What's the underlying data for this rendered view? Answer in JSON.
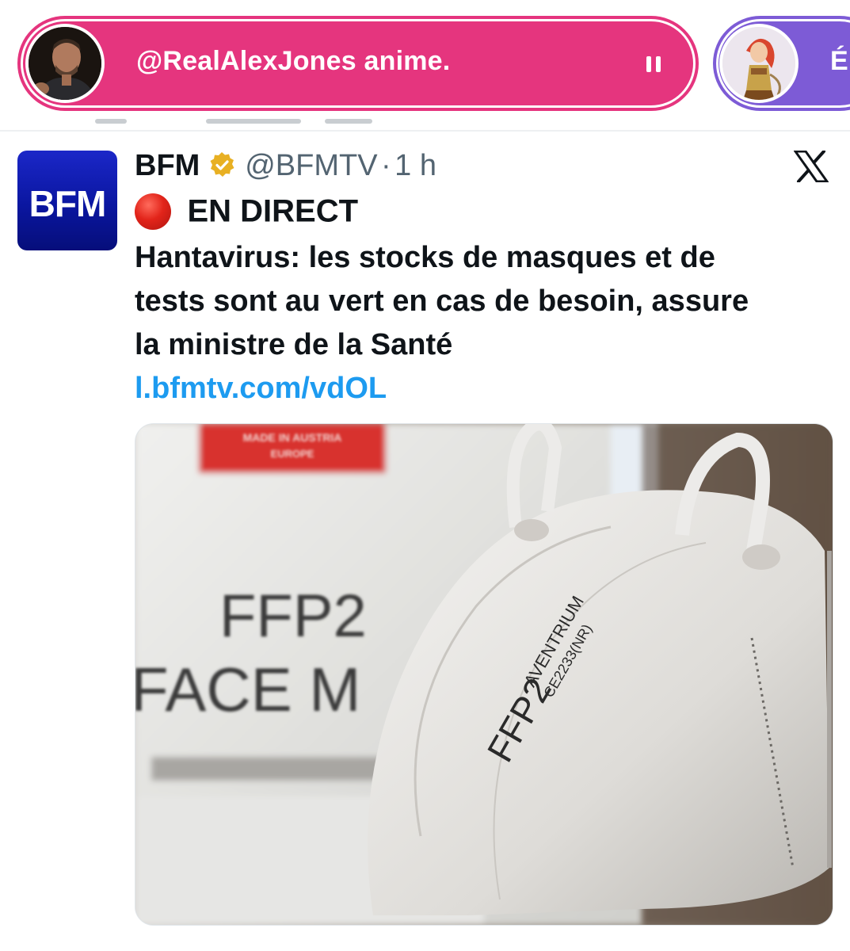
{
  "spaces_bar": {
    "active_space": {
      "title": "@RealAlexJones anime.",
      "color": "#e5357e",
      "control_icon": "pause-icon"
    },
    "next_space": {
      "title_partial": "É",
      "color": "#7d5bd6"
    }
  },
  "tweet": {
    "author": {
      "name": "BFM",
      "avatar_text": "BFM",
      "handle": "@BFMTV",
      "separator": "·",
      "time": "1 h",
      "verified_badge_color": "#e8b023"
    },
    "platform_icon": "x-logo-icon",
    "live_label": "EN DIRECT",
    "headline_lines": [
      "Hantavirus: les stocks de masques et de",
      "tests sont au vert en cas de besoin, assure",
      "la ministre de la Santé"
    ],
    "link": "l.bfmtv.com/vdOL",
    "link_color": "#1d9bf0",
    "media": {
      "box_red_label_lines": [
        "MADE IN AUSTRIA",
        "EUROPE"
      ],
      "box_text_lines": [
        "FFP2",
        "FACE M"
      ],
      "mask_print_lines": [
        "AVENTRIUM",
        "FFP2",
        "CE2233(NR)"
      ]
    }
  }
}
